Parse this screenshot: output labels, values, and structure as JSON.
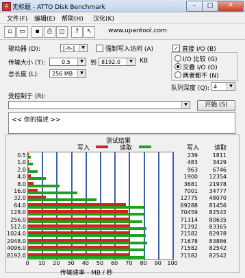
{
  "window": {
    "title": "无标题 - ATTO Disk Benchmark",
    "minimize": "–",
    "maximize": "□",
    "close": "✕"
  },
  "menu": [
    "文件(F)",
    "编辑(E)",
    "帮助(H)",
    "汉化(K)"
  ],
  "toolbar": {
    "url": "www.upantool.com"
  },
  "form": {
    "drive_label": "驱动器 (D):",
    "drive_value": "[-h-]",
    "force_write_label": "强制写入访问 (A)",
    "transfer_label": "传输大小 (T):",
    "transfer_from": "0.5",
    "to_label": "到",
    "transfer_to": "8192.0",
    "unit_kb": "KB",
    "length_label": "总长度 (L):",
    "length_value": "256 MB",
    "direct_io_label": "直接 I/O (B)",
    "io_compare": "I/O 比较 (G)",
    "io_overlap": "交叠 I/O (O)",
    "io_none": "两者都不 (N)",
    "queue_label": "队列深度 (Q):",
    "queue_value": "4",
    "controlled_label": "受控制于 (R):",
    "start_button": "开始 (S)",
    "description": "<<  你的描述   >>"
  },
  "chart_title": "测试结果",
  "legend_write": "写入",
  "legend_read": "读取",
  "col_write": "写入",
  "col_read": "读取",
  "xlabel": "传输速率 - MB / 秒",
  "colors": {
    "write": "#d42020",
    "read": "#20a020",
    "grid": "#3d5fa8"
  },
  "chart_data": {
    "type": "bar",
    "categories": [
      "0.5",
      "1.0",
      "2.0",
      "4.0",
      "8.0",
      "16.0",
      "32.0",
      "64.0",
      "128.0",
      "256.0",
      "512.0",
      "1024.0",
      "2048.0",
      "4096.0",
      "8192.0"
    ],
    "series": [
      {
        "name": "写入",
        "values": [
          239,
          483,
          963,
          1900,
          3681,
          7001,
          12775,
          69288,
          70459,
          71314,
          71392,
          71582,
          71678,
          71582,
          71582
        ]
      },
      {
        "name": "读取",
        "values": [
          1811,
          3429,
          6746,
          12354,
          21978,
          34777,
          48070,
          81456,
          82542,
          80635,
          83365,
          82978,
          83886,
          82542,
          82542
        ]
      }
    ],
    "xticks": [
      "0",
      "10",
      "20",
      "30",
      "40",
      "50",
      "60",
      "70",
      "80",
      "90",
      "100"
    ],
    "xlim": [
      0,
      100
    ],
    "xlabel": "传输速率 - MB / 秒"
  },
  "watermark": "U盘量产网 www.upantool.com"
}
